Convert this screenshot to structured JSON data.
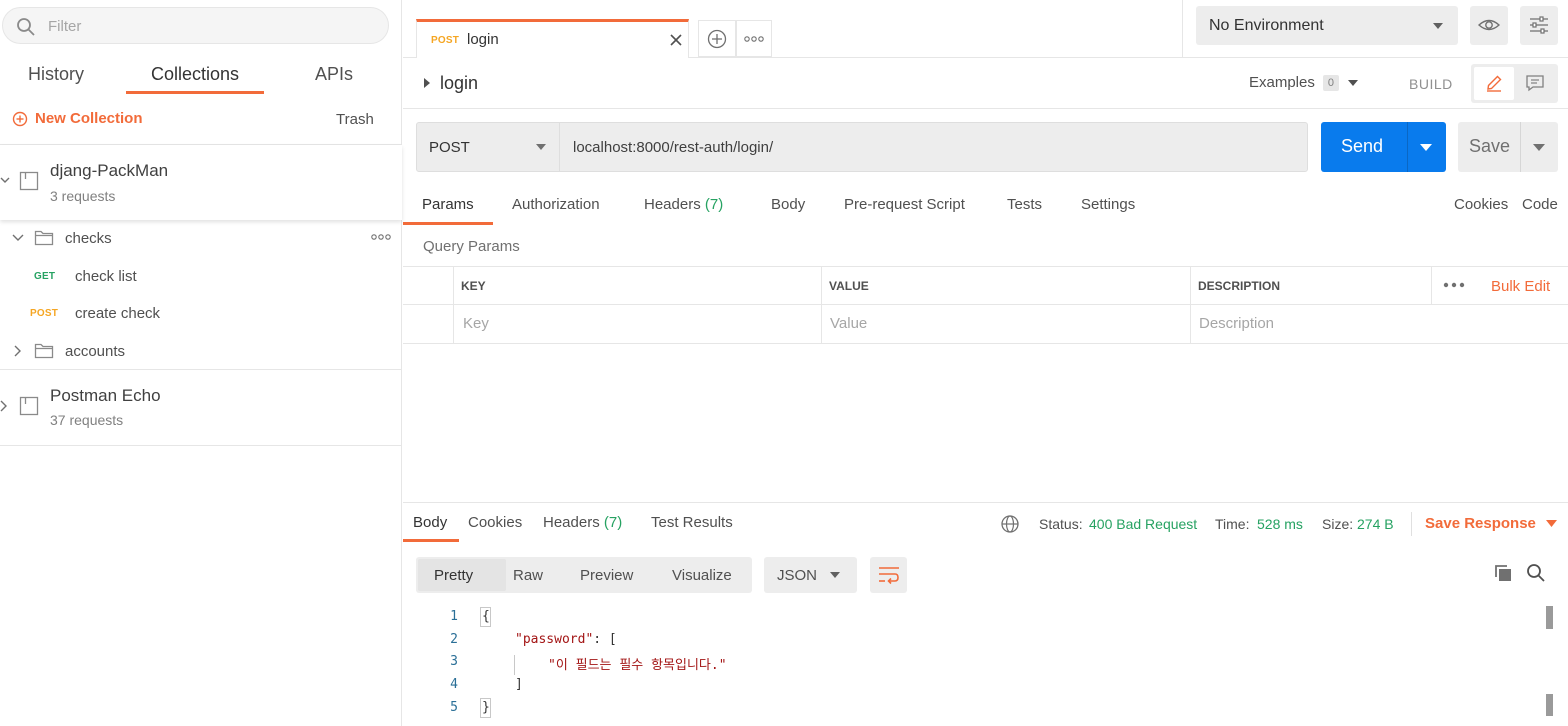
{
  "sidebar": {
    "filter_placeholder": "Filter",
    "tabs": [
      "History",
      "Collections",
      "APIs"
    ],
    "active_tab": "Collections",
    "new_collection": "New Collection",
    "trash": "Trash",
    "collections": [
      {
        "name": "djang-PackMan",
        "subtitle": "3 requests",
        "expanded": true,
        "folders": [
          {
            "name": "checks",
            "expanded": true,
            "requests": [
              {
                "method": "GET",
                "name": "check list"
              },
              {
                "method": "POST",
                "name": "create check"
              }
            ]
          },
          {
            "name": "accounts",
            "expanded": false
          }
        ]
      },
      {
        "name": "Postman Echo",
        "subtitle": "37 requests",
        "expanded": false
      }
    ]
  },
  "request_tab": {
    "method": "POST",
    "name": "login"
  },
  "environment": {
    "selected": "No Environment"
  },
  "request": {
    "breadcrumb": "login",
    "examples_label": "Examples",
    "examples_count": "0",
    "build_label": "BUILD",
    "method": "POST",
    "url": "localhost:8000/rest-auth/login/",
    "send_label": "Send",
    "save_label": "Save",
    "tabs": {
      "params": "Params",
      "authorization": "Authorization",
      "headers": "Headers",
      "headers_count": "(7)",
      "body": "Body",
      "prerequest": "Pre-request Script",
      "tests": "Tests",
      "settings": "Settings"
    },
    "cookies_link": "Cookies",
    "code_link": "Code",
    "query_params_title": "Query Params",
    "table": {
      "headers": [
        "KEY",
        "VALUE",
        "DESCRIPTION"
      ],
      "bulk_edit": "Bulk Edit",
      "placeholders": [
        "Key",
        "Value",
        "Description"
      ]
    }
  },
  "response": {
    "tabs": {
      "body": "Body",
      "cookies": "Cookies",
      "headers": "Headers",
      "headers_count": "(7)",
      "tests": "Test Results"
    },
    "status_label": "Status:",
    "status_value": "400 Bad Request",
    "time_label": "Time:",
    "time_value": "528 ms",
    "size_label": "Size:",
    "size_value": "274 B",
    "save_response": "Save Response",
    "view_modes": [
      "Pretty",
      "Raw",
      "Preview",
      "Visualize"
    ],
    "format": "JSON",
    "body_lines": [
      {
        "n": "1",
        "text": "{"
      },
      {
        "n": "2",
        "key": "\"password\"",
        "rest": ": ["
      },
      {
        "n": "3",
        "str": "\"이 필드는 필수 항목입니다.\""
      },
      {
        "n": "4",
        "text": "]"
      },
      {
        "n": "5",
        "text": "}"
      }
    ]
  },
  "colors": {
    "accent": "#f26b3a",
    "send_blue": "#097bed",
    "success_green": "#26a262",
    "post_yellow": "#f5a623"
  }
}
